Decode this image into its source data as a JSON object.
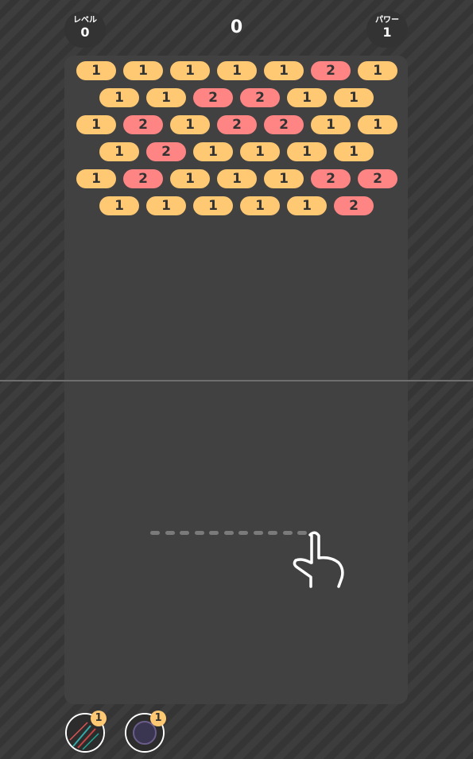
{
  "hud": {
    "level_label": "レベル",
    "level_value": "0",
    "score": "0",
    "power_label": "パワー",
    "power_value": "1"
  },
  "colors": {
    "hp1": "#ffc872",
    "hp2": "#ff8584",
    "board": "#414141",
    "background": "#3a3a3a"
  },
  "bricks": [
    [
      "1",
      "1",
      "1",
      "1",
      "1",
      "2",
      "1"
    ],
    [
      "1",
      "1",
      "2",
      "2",
      "1",
      "1"
    ],
    [
      "1",
      "2",
      "1",
      "2",
      "2",
      "1",
      "1"
    ],
    [
      "1",
      "2",
      "1",
      "1",
      "1",
      "1"
    ],
    [
      "1",
      "2",
      "1",
      "1",
      "1",
      "2",
      "2"
    ],
    [
      "1",
      "1",
      "1",
      "1",
      "1",
      "2"
    ]
  ],
  "items": [
    {
      "icon": "multi-ball-icon",
      "count": "1"
    },
    {
      "icon": "dark-orb-icon",
      "count": "1"
    }
  ]
}
